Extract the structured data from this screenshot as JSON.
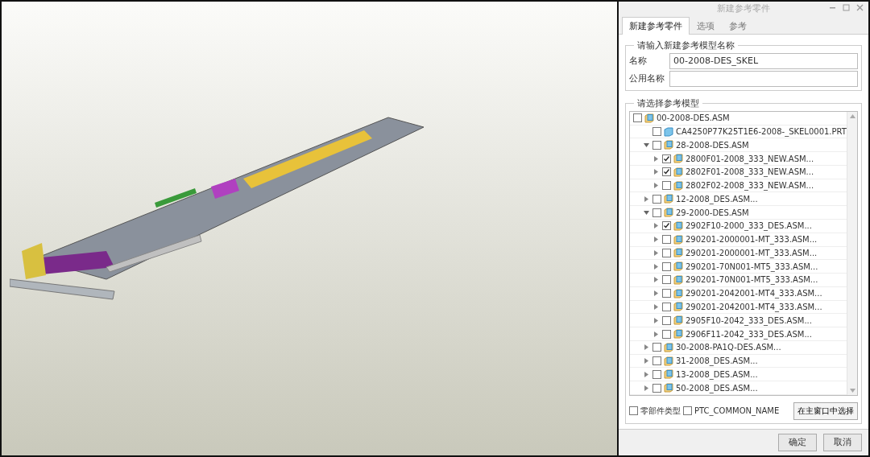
{
  "dialog": {
    "title": "新建参考零件",
    "tabs": [
      {
        "label": "新建参考零件",
        "selected": true
      },
      {
        "label": "选项",
        "selected": false
      },
      {
        "label": "参考",
        "selected": false
      }
    ],
    "name_group": {
      "title": "请输入新建参考模型名称",
      "fields": [
        {
          "label": "名称",
          "value": "00-2008-DES_SKEL"
        },
        {
          "label": "公用名称"
        }
      ]
    },
    "model_group": {
      "title": "请选择参考模型",
      "tree": [
        {
          "label": "00-2008-DES.ASM",
          "kind": "asm",
          "checked": false,
          "children": [
            {
              "label": "CA4250P77K25T1E6-2008-_SKEL0001.PRT",
              "kind": "prt",
              "checked": false
            },
            {
              "label": "28-2008-DES.ASM",
              "kind": "asm",
              "checked": false,
              "expanded": true,
              "children": [
                {
                  "label": "2800F01-2008_333_NEW.ASM...",
                  "kind": "asm",
                  "checked": true,
                  "expanded": false
                },
                {
                  "label": "2802F01-2008_333_NEW.ASM...",
                  "kind": "asm",
                  "checked": true,
                  "expanded": false
                },
                {
                  "label": "2802F02-2008_333_NEW.ASM...",
                  "kind": "asm",
                  "checked": false,
                  "expanded": false
                }
              ]
            },
            {
              "label": "12-2008_DES.ASM...",
              "kind": "asm",
              "checked": false,
              "expanded": false
            },
            {
              "label": "29-2000-DES.ASM",
              "kind": "asm",
              "checked": false,
              "expanded": true,
              "children": [
                {
                  "label": "2902F10-2000_333_DES.ASM...",
                  "kind": "asm",
                  "checked": true,
                  "expanded": false
                },
                {
                  "label": "290201-2000001-MT_333.ASM...",
                  "kind": "asm",
                  "checked": false,
                  "expanded": false
                },
                {
                  "label": "290201-2000001-MT_333.ASM...",
                  "kind": "asm",
                  "checked": false,
                  "expanded": false
                },
                {
                  "label": "290201-70N001-MT5_333.ASM...",
                  "kind": "asm",
                  "checked": false,
                  "expanded": false
                },
                {
                  "label": "290201-70N001-MT5_333.ASM...",
                  "kind": "asm",
                  "checked": false,
                  "expanded": false
                },
                {
                  "label": "290201-2042001-MT4_333.ASM...",
                  "kind": "asm",
                  "checked": false,
                  "expanded": false
                },
                {
                  "label": "290201-2042001-MT4_333.ASM...",
                  "kind": "asm",
                  "checked": false,
                  "expanded": false
                },
                {
                  "label": "2905F10-2042_333_DES.ASM...",
                  "kind": "asm",
                  "checked": false,
                  "expanded": false
                },
                {
                  "label": "2906F11-2042_333_DES.ASM...",
                  "kind": "asm",
                  "checked": false,
                  "expanded": false
                }
              ]
            },
            {
              "label": "30-2008-PA1Q-DES.ASM...",
              "kind": "asm",
              "checked": false,
              "expanded": false
            },
            {
              "label": "31-2008_DES.ASM...",
              "kind": "asm",
              "checked": false,
              "expanded": false
            },
            {
              "label": "13-2008_DES.ASM...",
              "kind": "asm",
              "checked": false,
              "expanded": false
            },
            {
              "label": "50-2008_DES.ASM...",
              "kind": "asm",
              "checked": false,
              "expanded": false
            }
          ]
        }
      ],
      "options": [
        {
          "label": "零部件类型",
          "checked": false
        },
        {
          "label": "PTC_COMMON_NAME",
          "checked": false
        }
      ],
      "select_button": "在主窗口中选择"
    },
    "buttons": [
      "确定",
      "取消"
    ]
  }
}
